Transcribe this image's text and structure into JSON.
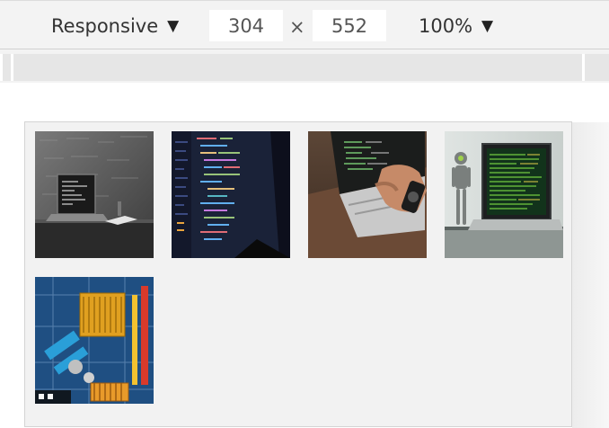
{
  "toolbar": {
    "device_label": "Responsive",
    "width_value": "304",
    "height_value": "552",
    "dimension_separator": "×",
    "zoom_label": "100%",
    "caret": "▼"
  },
  "gallery": {
    "images": [
      {
        "subject": "monochrome laptop on desk"
      },
      {
        "subject": "code editor on screen"
      },
      {
        "subject": "hand typing on laptop"
      },
      {
        "subject": "robot figure beside laptop"
      },
      {
        "subject": "motherboard close-up"
      }
    ]
  }
}
